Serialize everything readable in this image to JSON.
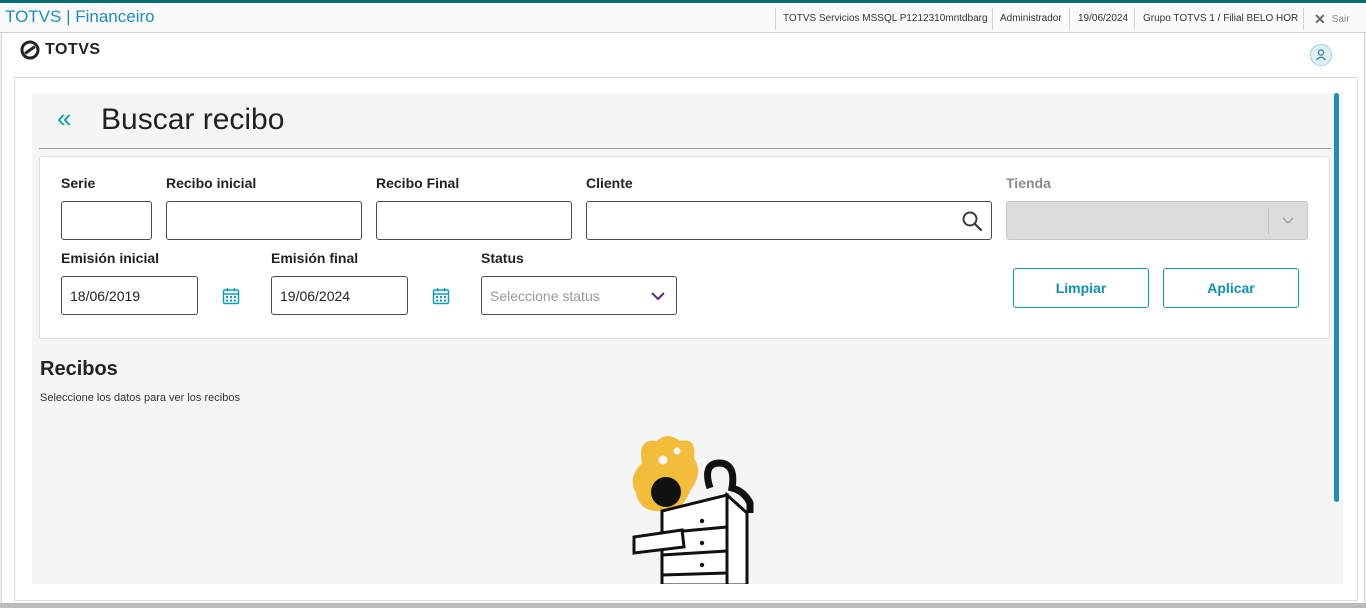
{
  "titlebar": {
    "app_title": "TOTVS | Financeiro",
    "environment": "TOTVS Servicios MSSQL P1212310mntdbarg",
    "user": "Administrador",
    "date": "19/06/2024",
    "branch": "Grupo TOTVS 1 / Filial BELO HOR",
    "exit_label": "Sair"
  },
  "header": {
    "logo_text": "TOTVS",
    "avatar_icon": "user-icon"
  },
  "page": {
    "title": "Buscar recibo",
    "back_icon": "double-chevron-left-icon"
  },
  "filters": {
    "serie": {
      "label": "Serie",
      "value": ""
    },
    "recibo_inicial": {
      "label": "Recibo inicial",
      "value": ""
    },
    "recibo_final": {
      "label": "Recibo Final",
      "value": ""
    },
    "cliente": {
      "label": "Cliente",
      "value": ""
    },
    "tienda": {
      "label": "Tienda",
      "value": ""
    },
    "emision_inicial": {
      "label": "Emisión inicial",
      "value": "18/06/2019"
    },
    "emision_final": {
      "label": "Emisión final",
      "value": "19/06/2024"
    },
    "status": {
      "label": "Status",
      "placeholder": "Seleccione status"
    },
    "clear_label": "Limpiar",
    "apply_label": "Aplicar"
  },
  "results": {
    "title": "Recibos",
    "subtitle": "Seleccione los datos para ver los recibos"
  },
  "colors": {
    "accent": "#0c9ab8",
    "title_blue": "#1a8fbf",
    "illustration_yellow": "#f3bd3c"
  }
}
